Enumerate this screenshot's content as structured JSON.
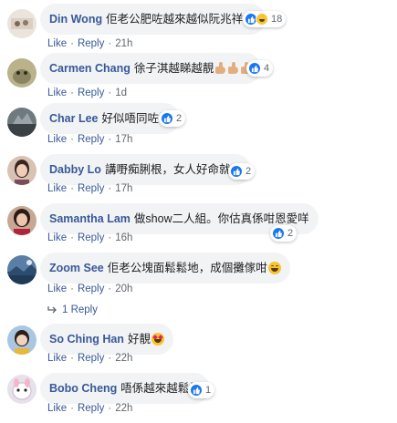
{
  "comments": [
    {
      "author": "Din Wong",
      "text": "佢老公肥咗越來越似阮兆祥",
      "emoji": "haha-emoji",
      "reactions": {
        "icons": [
          "like",
          "haha"
        ],
        "count": "18"
      },
      "actions": {
        "like": "Like",
        "reply": "Reply"
      },
      "time": "21h"
    },
    {
      "author": "Carmen Chang",
      "text": "徐子淇越睇越靚",
      "emoji": "thumbs-up-x3",
      "reactions": {
        "icons": [
          "like"
        ],
        "count": "4"
      },
      "actions": {
        "like": "Like",
        "reply": "Reply"
      },
      "time": "1d"
    },
    {
      "author": "Char Lee",
      "text": "好似唔同咗樣",
      "reactions": {
        "icons": [
          "like"
        ],
        "count": "2"
      },
      "actions": {
        "like": "Like",
        "reply": "Reply"
      },
      "time": "17h"
    },
    {
      "author": "Dabby Lo",
      "text": "講嘢痴脷根，女人好命就得",
      "reactions": {
        "icons": [
          "like"
        ],
        "count": "2"
      },
      "actions": {
        "like": "Like",
        "reply": "Reply"
      },
      "time": "17h"
    },
    {
      "author": "Samantha Lam",
      "text": "做show二人組。你估真係咁恩愛咩",
      "reactions": {
        "icons": [
          "like"
        ],
        "count": "2"
      },
      "actions": {
        "like": "Like",
        "reply": "Reply"
      },
      "time": "16h"
    },
    {
      "author": "Zoom See",
      "text": "佢老公塊面鬆鬆地，成個攤傢咁",
      "emoji": "laugh-emoji",
      "actions": {
        "like": "Like",
        "reply": "Reply"
      },
      "time": "20h",
      "replies_label": "1 Reply"
    },
    {
      "author": "So Ching Han",
      "text": "好靚",
      "emoji": "heart-eyes-emoji",
      "actions": {
        "like": "Like",
        "reply": "Reply"
      },
      "time": "22h"
    },
    {
      "author": "Bobo Cheng",
      "text": "唔係越來越鬆樣",
      "reactions": {
        "icons": [
          "like"
        ],
        "count": "1"
      },
      "actions": {
        "like": "Like",
        "reply": "Reply"
      },
      "time": "22h"
    }
  ],
  "colors": {
    "link": "#385898",
    "bubble": "#f2f3f5",
    "meta": "#606770",
    "like_reaction": "#1877f2",
    "haha_reaction": "#f7c531"
  }
}
